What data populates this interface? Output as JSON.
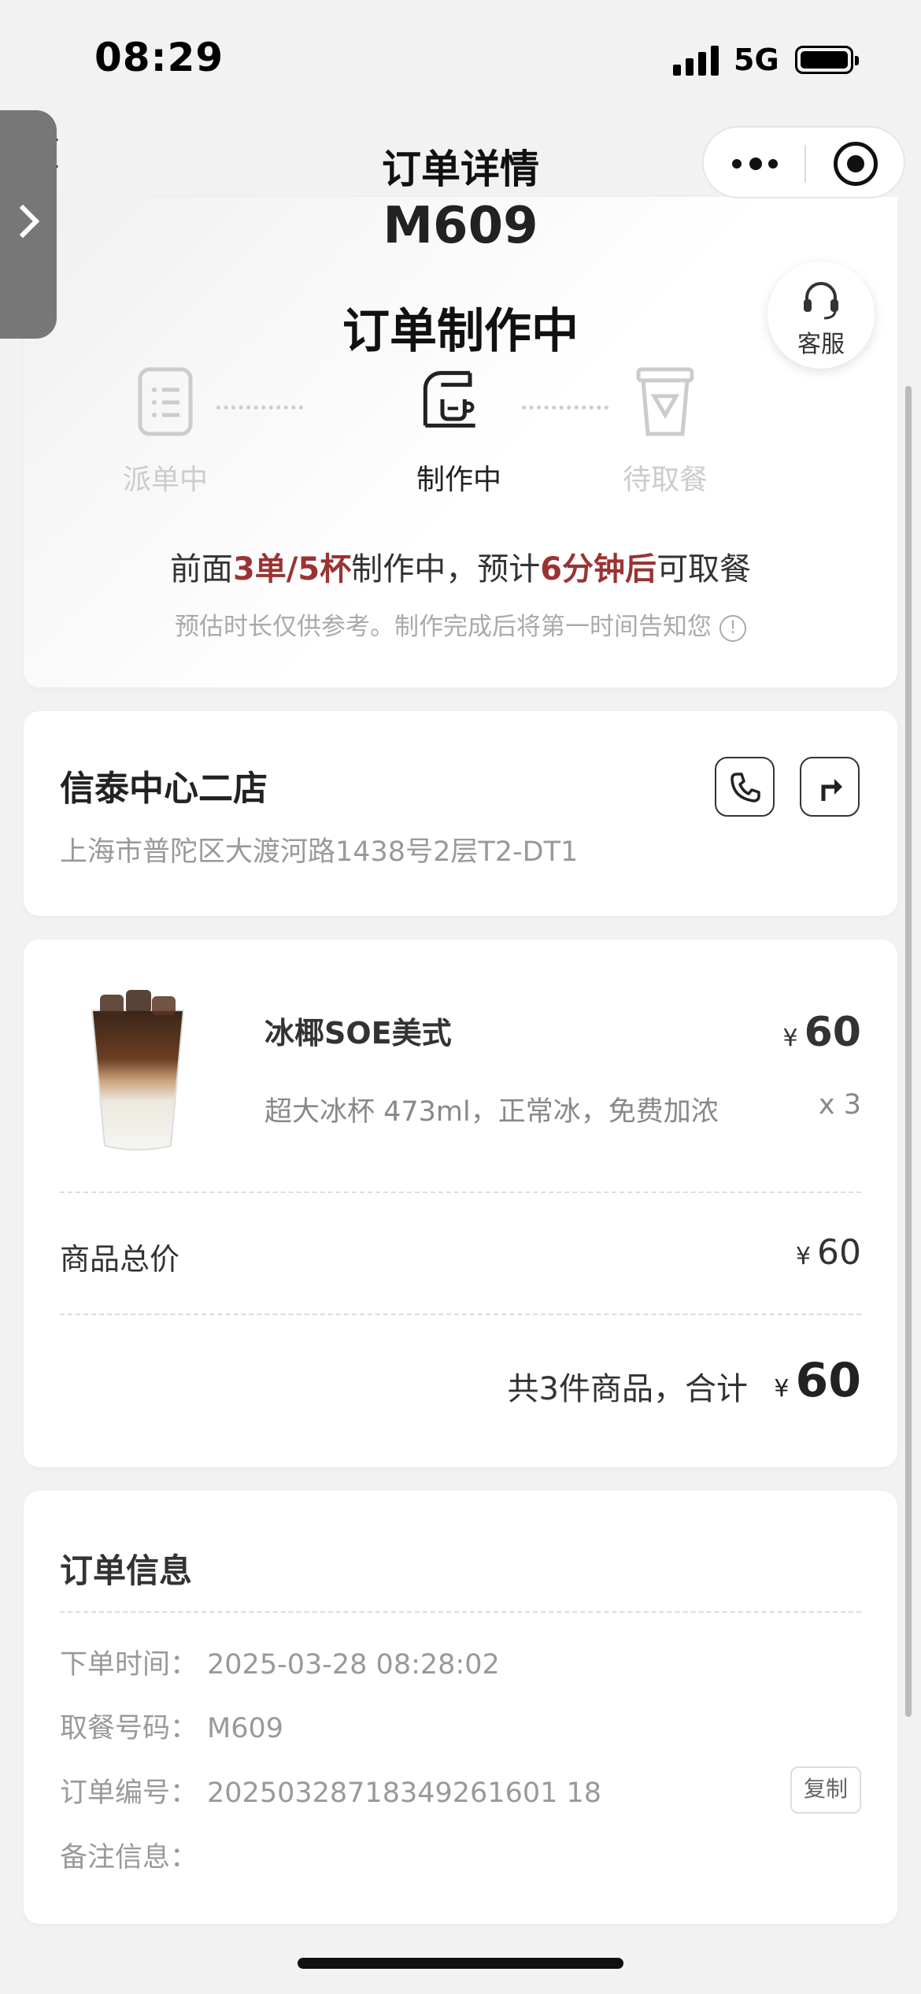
{
  "status_bar": {
    "time": "08:29",
    "network": "5G"
  },
  "nav": {
    "title": "订单详情"
  },
  "order_status": {
    "pickup_code": "M609",
    "title": "订单制作中",
    "customer_service_label": "客服",
    "steps": [
      {
        "label": "派单中",
        "state": "done"
      },
      {
        "label": "制作中",
        "state": "active"
      },
      {
        "label": "待取餐",
        "state": "pending"
      }
    ],
    "eta": {
      "prefix": "前面",
      "queue": "3单/5杯",
      "middle": "制作中，预计",
      "time": "6分钟后",
      "suffix": "可取餐"
    },
    "note": "预估时长仅供参考。制作完成后将第一时间告知您",
    "accent_color": "#9b3333"
  },
  "store": {
    "name": "信泰中心二店",
    "address": "上海市普陀区大渡河路1438号2层T2-DT1"
  },
  "items": {
    "product": {
      "name": "冰椰SOE美式",
      "currency": "¥",
      "price": "60",
      "spec": "超大冰杯 473ml，正常冰，免费加浓",
      "qty": "x 3"
    },
    "total_label": "商品总价",
    "total_currency": "¥",
    "total_value": "60",
    "summary_label": "共3件商品，合计",
    "summary_currency": "¥",
    "summary_value": "60"
  },
  "order_info": {
    "title": "订单信息",
    "rows": [
      {
        "label": "下单时间：",
        "value": "2025-03-28 08:28:02"
      },
      {
        "label": "取餐号码：",
        "value": "M609"
      },
      {
        "label": "订单编号：",
        "value": "20250328718349261601 18"
      },
      {
        "label": "备注信息：",
        "value": ""
      }
    ],
    "copy_label": "复制"
  }
}
